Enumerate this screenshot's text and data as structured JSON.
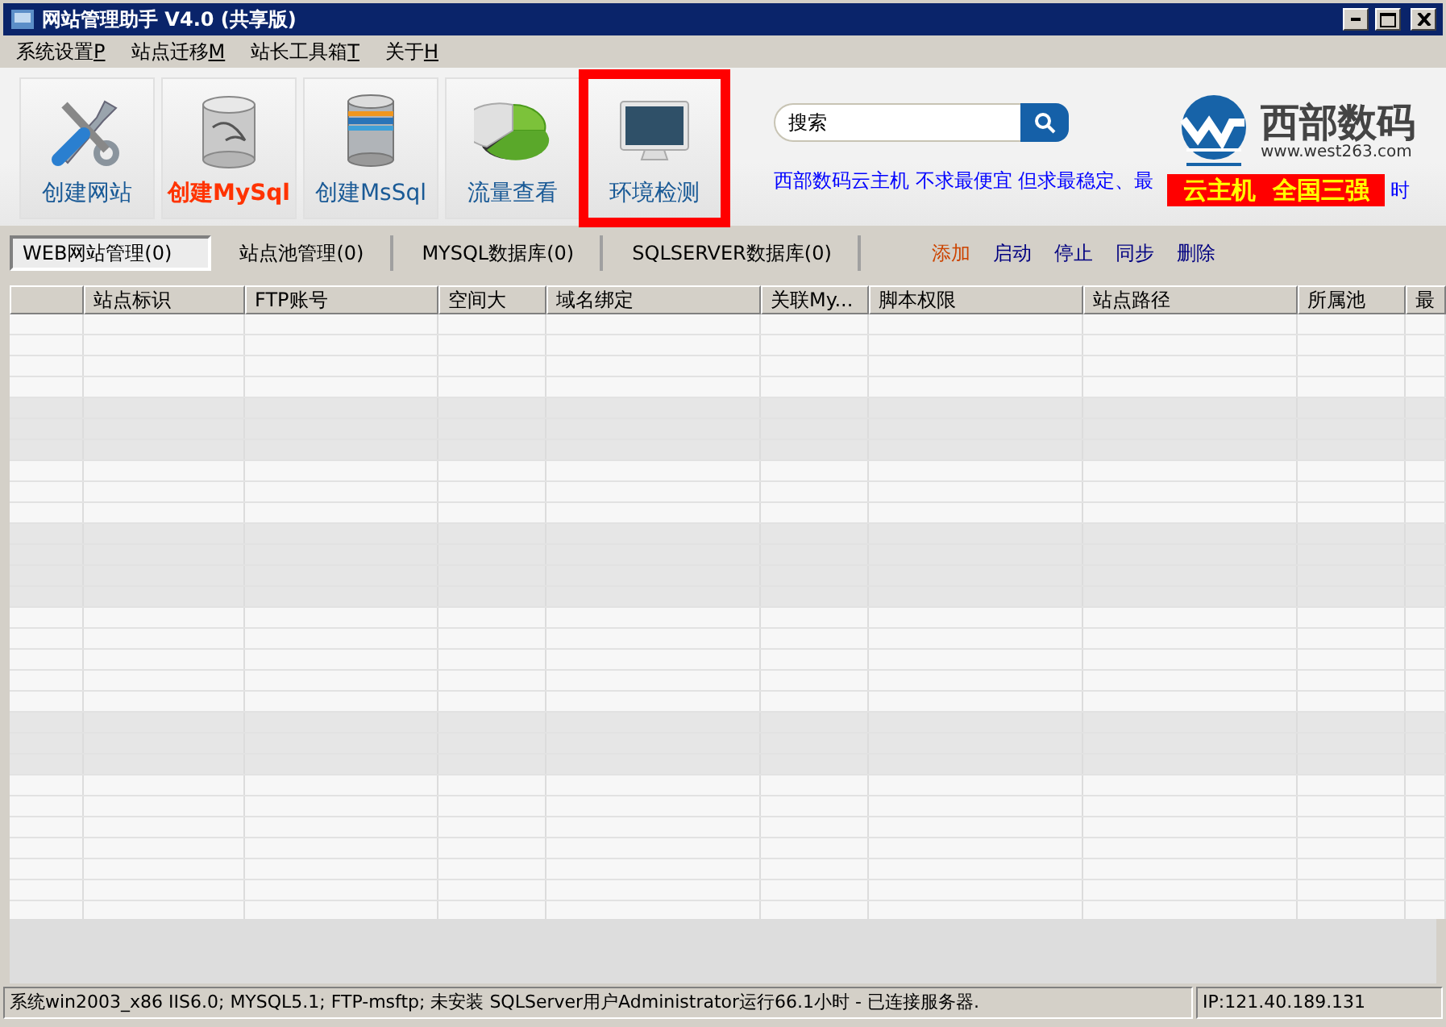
{
  "window": {
    "title": "网站管理助手 V4.0 (共享版)"
  },
  "menu": [
    {
      "label": "系统设置",
      "accel": "P"
    },
    {
      "label": "站点迁移",
      "accel": "M"
    },
    {
      "label": "站长工具箱",
      "accel": "T"
    },
    {
      "label": "关于",
      "accel": "H"
    }
  ],
  "toolbar": [
    {
      "label": "创建网站",
      "selected": false,
      "highlighted": false
    },
    {
      "label": "创建MySql",
      "selected": true,
      "highlighted": false
    },
    {
      "label": "创建MsSql",
      "selected": false,
      "highlighted": false
    },
    {
      "label": "流量查看",
      "selected": false,
      "highlighted": false
    },
    {
      "label": "环境检测",
      "selected": false,
      "highlighted": true
    }
  ],
  "search": {
    "placeholder": "搜索"
  },
  "logo": {
    "name": "西部数码",
    "url": "www.west263.com"
  },
  "marquee": {
    "text": "西部数码云主机  不求最便宜  但求最稳定、最",
    "banner": "云主机  全国三强",
    "tail": "时"
  },
  "tabs": [
    {
      "label": "WEB网站管理(0)",
      "selected": true
    },
    {
      "label": "站点池管理(0)",
      "selected": false
    },
    {
      "label": "MYSQL数据库(0)",
      "selected": false
    },
    {
      "label": "SQLSERVER数据库(0)",
      "selected": false
    }
  ],
  "actions": [
    {
      "label": "添加",
      "kind": "accent"
    },
    {
      "label": "启动",
      "kind": "link"
    },
    {
      "label": "停止",
      "kind": "link"
    },
    {
      "label": "同步",
      "kind": "link"
    },
    {
      "label": "删除",
      "kind": "link"
    }
  ],
  "table": {
    "columns": [
      "站点标识",
      "FTP账号",
      "空间大",
      "域名绑定",
      "关联My...",
      "脚本权限",
      "站点路径",
      "所属池",
      "最"
    ]
  },
  "status_bar": {
    "info": "系统win2003_x86 IIS6.0; MYSQL5.1; FTP-msftp; 未安装 SQLServer用户Administrator运行66.1小时 - 已连接服务器.",
    "ip": "IP:121.40.189.131"
  }
}
